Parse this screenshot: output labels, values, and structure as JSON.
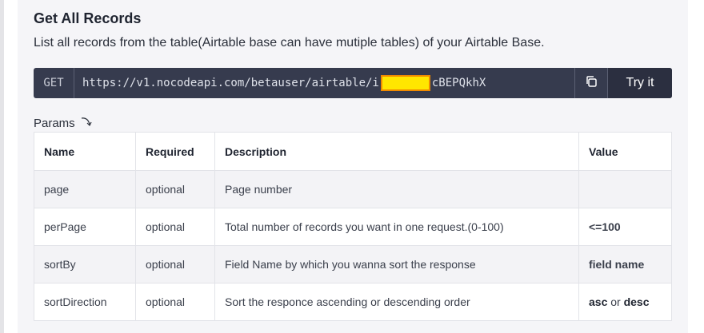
{
  "section": {
    "title": "Get All Records",
    "description": "List all records from the table(Airtable base can have mutiple tables) of your Airtable Base."
  },
  "endpoint": {
    "method": "GET",
    "url_start": "https://v1.nocodeapi.com/betauser/airtable/i",
    "url_end": "cBEPQkhX",
    "copy_icon": "copy-icon",
    "try_label": "Try it"
  },
  "params_label": "Params",
  "table": {
    "headers": [
      "Name",
      "Required",
      "Description",
      "Value"
    ],
    "rows": [
      {
        "name": "page",
        "required": "optional",
        "description": "Page number",
        "value": ""
      },
      {
        "name": "perPage",
        "required": "optional",
        "description": "Total number of records you want in one request.(0-100)",
        "value": "<=100"
      },
      {
        "name": "sortBy",
        "required": "optional",
        "description": "Field Name by which you wanna sort the response",
        "value": "field name"
      },
      {
        "name": "sortDirection",
        "required": "optional",
        "description": "Sort the responce ascending or descending order",
        "value_a": "asc",
        "value_or": " or ",
        "value_b": "desc"
      }
    ]
  }
}
